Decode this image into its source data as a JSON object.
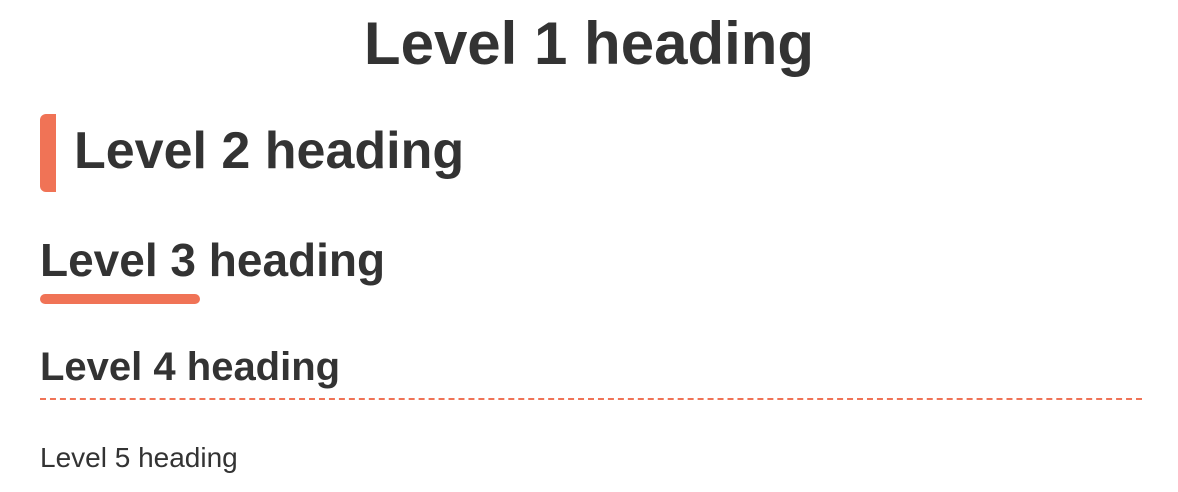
{
  "headings": {
    "h1": "Level 1 heading",
    "h2": "Level 2 heading",
    "h3": "Level 3 heading",
    "h4": "Level 4 heading",
    "h5": "Level 5 heading"
  },
  "colors": {
    "text": "#333333",
    "accent": "#f07356",
    "background": "#ffffff"
  }
}
